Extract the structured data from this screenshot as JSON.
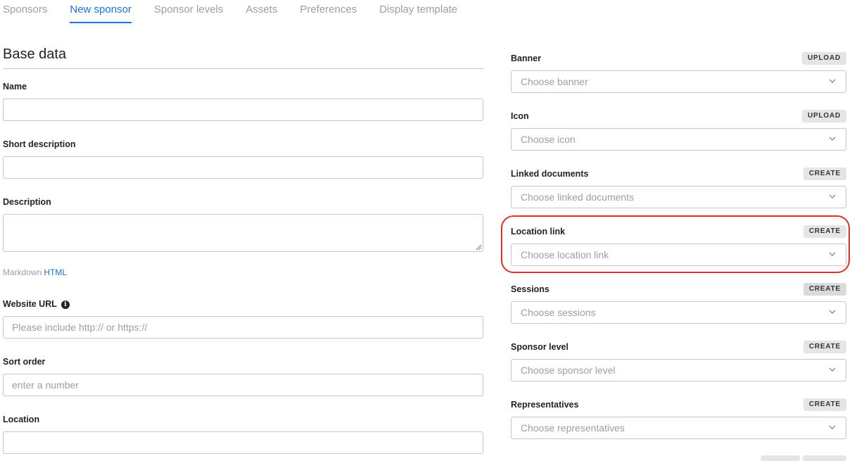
{
  "tabs": [
    {
      "label": "Sponsors",
      "active": false
    },
    {
      "label": "New sponsor",
      "active": true
    },
    {
      "label": "Sponsor levels",
      "active": false
    },
    {
      "label": "Assets",
      "active": false
    },
    {
      "label": "Preferences",
      "active": false
    },
    {
      "label": "Display template",
      "active": false
    }
  ],
  "left": {
    "section_title": "Base data",
    "name_label": "Name",
    "short_desc_label": "Short description",
    "description_label": "Description",
    "markdown_text": "Markdown",
    "html_text": "HTML",
    "website_label": "Website URL",
    "website_placeholder": "Please include http:// or https://",
    "sort_label": "Sort order",
    "sort_placeholder": "enter a number",
    "location_label": "Location"
  },
  "right": {
    "fields": [
      {
        "label": "Banner",
        "button": "UPLOAD",
        "placeholder": "Choose banner"
      },
      {
        "label": "Icon",
        "button": "UPLOAD",
        "placeholder": "Choose icon"
      },
      {
        "label": "Linked documents",
        "button": "CREATE",
        "placeholder": "Choose linked documents"
      },
      {
        "label": "Location link",
        "button": "CREATE",
        "placeholder": "Choose location link"
      },
      {
        "label": "Sessions",
        "button": "CREATE",
        "placeholder": "Choose sessions"
      },
      {
        "label": "Sponsor level",
        "button": "CREATE",
        "placeholder": "Choose sponsor level"
      },
      {
        "label": "Representatives",
        "button": "CREATE",
        "placeholder": "Choose representatives"
      }
    ]
  },
  "colors": {
    "accent": "#1a73d9",
    "highlight": "#e0302a"
  },
  "icons": {
    "dropdown": "chevron-down-icon",
    "info": "info-icon",
    "resize": "resize-handle-icon"
  }
}
